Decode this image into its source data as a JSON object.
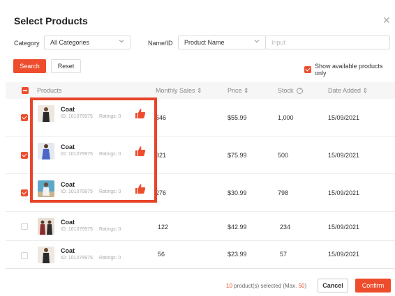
{
  "modal": {
    "title": "Select Products",
    "close_glyph": "✕"
  },
  "filters": {
    "category_label": "Category",
    "category_value": "All Categories",
    "nameid_label": "Name/ID",
    "nameid_type": "Product Name",
    "input_placeholder": "Input"
  },
  "actions": {
    "search_label": "Search",
    "reset_label": "Reset",
    "show_available_label": "Show available products only"
  },
  "table": {
    "headers": {
      "products": "Products",
      "monthly_sales": "Monthly Sales",
      "price": "Price",
      "stock": "Stock",
      "date_added": "Date Added",
      "sort_glyph": "⇕",
      "info_glyph": "?"
    },
    "rows": [
      {
        "name": "Coat",
        "id": "ID: 101079975",
        "ratings": "Ratings: 0",
        "sales": "546",
        "price": "$55.99",
        "stock": "1,000",
        "date": "15/09/2021",
        "checked": true,
        "thumbs_up": true
      },
      {
        "name": "Coat",
        "id": "ID: 101079975",
        "ratings": "Ratings: 0",
        "sales": "321",
        "price": "$75.99",
        "stock": "500",
        "date": "15/09/2021",
        "checked": true,
        "thumbs_up": true
      },
      {
        "name": "Coat",
        "id": "ID: 101079975",
        "ratings": "Ratings: 0",
        "sales": "276",
        "price": "$30.99",
        "stock": "798",
        "date": "15/09/2021",
        "checked": true,
        "thumbs_up": true
      },
      {
        "name": "Coat",
        "id": "ID: 101079975",
        "ratings": "Ratings: 0",
        "sales": "122",
        "price": "$42.99",
        "stock": "234",
        "date": "15/09/2021",
        "checked": false,
        "thumbs_up": false
      },
      {
        "name": "Coat",
        "id": "ID: 101079975",
        "ratings": "Ratings: 0",
        "sales": "56",
        "price": "$23.99",
        "stock": "57",
        "date": "15/09/2021",
        "checked": false,
        "thumbs_up": false
      }
    ]
  },
  "footer": {
    "selected_count": "10",
    "selected_text": " product(s) selected (Max. ",
    "max_count": "50",
    "close_paren": ")",
    "cancel_label": "Cancel",
    "confirm_label": "Confirm"
  },
  "colors": {
    "accent": "#ee4d2d",
    "highlight": "#e8442a"
  }
}
